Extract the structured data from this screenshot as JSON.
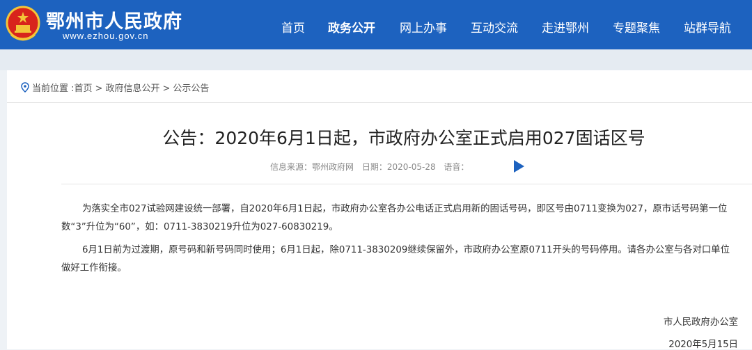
{
  "header": {
    "site_title": "鄂州市人民政府",
    "site_url": "www.ezhou.gov.cn",
    "nav": [
      {
        "label": "首页"
      },
      {
        "label": "政务公开",
        "active": true
      },
      {
        "label": "网上办事"
      },
      {
        "label": "互动交流"
      },
      {
        "label": "走进鄂州"
      },
      {
        "label": "专题聚焦"
      },
      {
        "label": "站群导航"
      }
    ]
  },
  "breadcrumb": {
    "prefix": "当前位置 :",
    "items": [
      "首页",
      "政府信息公开",
      "公示公告"
    ],
    "separator": ">"
  },
  "article": {
    "title": "公告：2020年6月1日起，市政府办公室正式启用027固话区号",
    "source": "信息来源：鄂州政府网",
    "date": "日期：2020-05-28",
    "voice": "语音：",
    "paragraphs": [
      "为落实全市027试验网建设统一部署，自2020年6月1日起，市政府办公室各办公电话正式启用新的固话号码，即区号由0711变换为027，原市话号码第一位数“3”升位为“60”，如：0711-3830219升位为027-60830219。",
      "6月1日前为过渡期，原号码和新号码同时使用；6月1日起，除0711-3830209继续保留外，市政府办公室原0711开头的号码停用。请各办公室与各对口单位做好工作衔接。"
    ],
    "signature_org": "市人民政府办公室",
    "signature_date": "2020年5月15日"
  },
  "colors": {
    "brand_blue": "#1d62bf",
    "band_gray": "#e5ebf2"
  }
}
